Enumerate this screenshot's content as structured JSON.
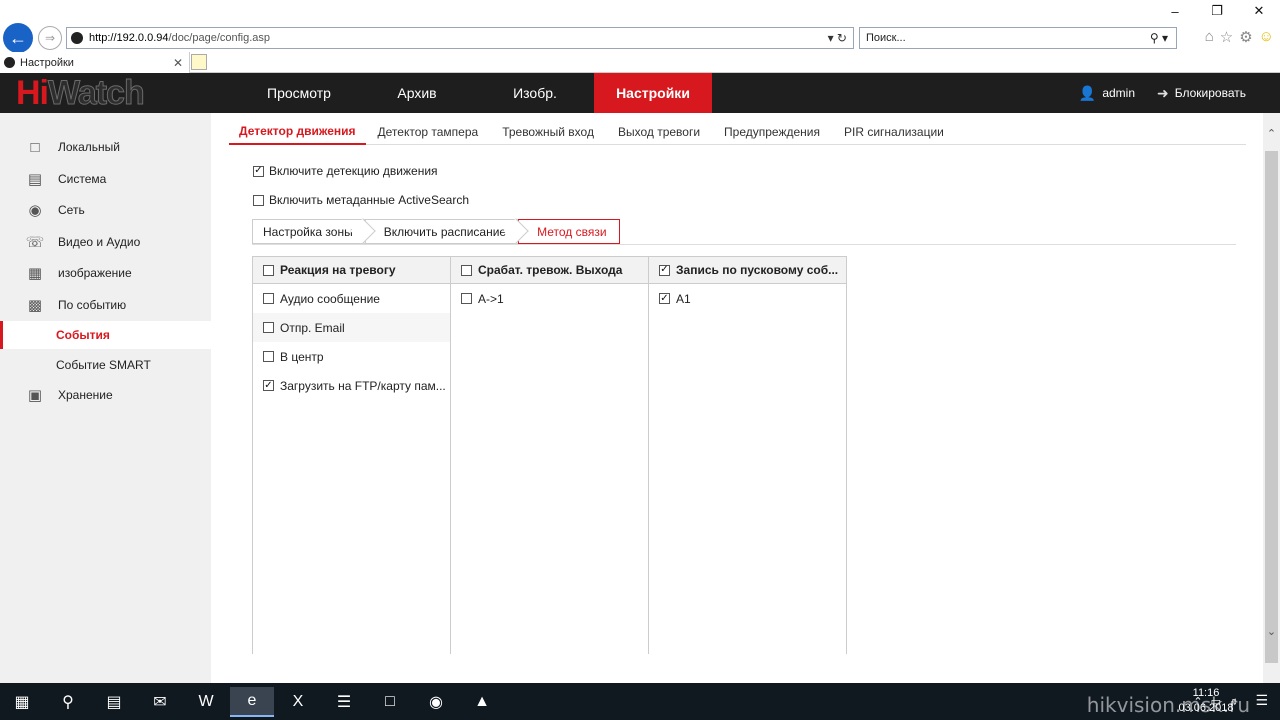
{
  "browser": {
    "url_host": "http://192.0.0.94",
    "url_path": "/doc/page/config.asp",
    "search_placeholder": "Поиск...",
    "tab_title": "Настройки",
    "window_controls": [
      "–",
      "❐",
      "✕"
    ]
  },
  "app": {
    "logo_hi": "Hi",
    "logo_watch": "Watch",
    "nav": [
      "Просмотр",
      "Архив",
      "Изобр.",
      "Настройки"
    ],
    "nav_active": 3,
    "user": "admin",
    "lock": "Блокировать"
  },
  "sidebar": {
    "items": [
      {
        "label": "Локальный",
        "icon": "monitor-icon"
      },
      {
        "label": "Система",
        "icon": "system-icon"
      },
      {
        "label": "Сеть",
        "icon": "network-icon"
      },
      {
        "label": "Видео и Аудио",
        "icon": "video-audio-icon"
      },
      {
        "label": "изображение",
        "icon": "image-icon"
      },
      {
        "label": "По событию",
        "icon": "event-icon"
      }
    ],
    "sub": [
      "События",
      "Событие SMART"
    ],
    "storage": {
      "label": "Хранение",
      "icon": "storage-icon"
    }
  },
  "subtabs": [
    "Детектор движения",
    "Детектор тампера",
    "Тревожный вход",
    "Выход тревоги",
    "Предупреждения",
    "PIR сигнализации"
  ],
  "options": {
    "enable_motion": {
      "label": "Включите детекцию движения",
      "checked": true
    },
    "enable_meta": {
      "label": "Включить метаданные ActiveSearch",
      "checked": false
    }
  },
  "steps": [
    "Настройка зоны",
    "Включить расписание",
    "Метод связи"
  ],
  "columns": [
    {
      "header": "Реакция на тревогу",
      "header_checked": false,
      "rows": [
        {
          "label": "Аудио сообщение",
          "checked": false
        },
        {
          "label": "Отпр. Email",
          "checked": false
        },
        {
          "label": "В центр",
          "checked": false
        },
        {
          "label": "Загрузить на FTP/карту пам...",
          "checked": true
        }
      ]
    },
    {
      "header": "Срабат. тревож. Выхода",
      "header_checked": false,
      "rows": [
        {
          "label": "A->1",
          "checked": false
        }
      ]
    },
    {
      "header": "Запись по пусковому соб...",
      "header_checked": true,
      "rows": [
        {
          "label": "A1",
          "checked": true
        }
      ]
    }
  ],
  "taskbar": {
    "time": "11:16",
    "date": "03.06.2018",
    "watermark": "hikvision.msk.ru"
  }
}
